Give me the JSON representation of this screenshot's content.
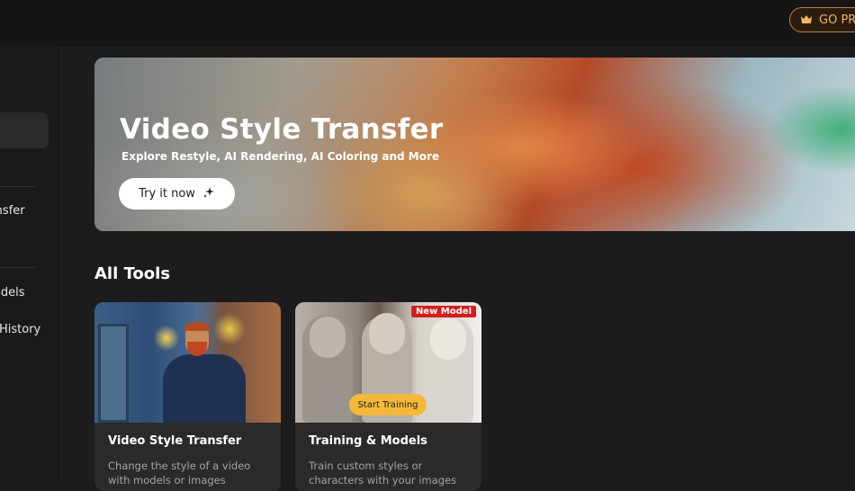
{
  "header": {
    "go_pro_label": "GO PRO"
  },
  "sidebar": {
    "items": [
      {
        "label": "Video Style Transfer"
      },
      {
        "label": "Training & Models"
      },
      {
        "label": "History"
      }
    ]
  },
  "hero": {
    "title": "Video Style Transfer",
    "subtitle": "Explore Restyle, AI Rendering, AI Coloring and More",
    "button_label": "Try it now"
  },
  "main": {
    "section_title": "All Tools",
    "cards": [
      {
        "title": "Video Style Transfer",
        "description": "Change the style of a video with models or images",
        "thumbnail_icon": "van-gogh-portrait-thumbnail"
      },
      {
        "title": "Training & Models",
        "description": "Train custom styles or characters with your images",
        "badge": "New Model",
        "action_label": "Start Training",
        "thumbnail_icon": "statue-busts-thumbnail"
      }
    ]
  },
  "colors": {
    "background": "#1c1c1e",
    "topbar": "#151516",
    "card": "#2a2a2c",
    "pro_accent": "#f3b45e",
    "badge_red": "#d51d1d",
    "training_button": "#f4b93a"
  }
}
